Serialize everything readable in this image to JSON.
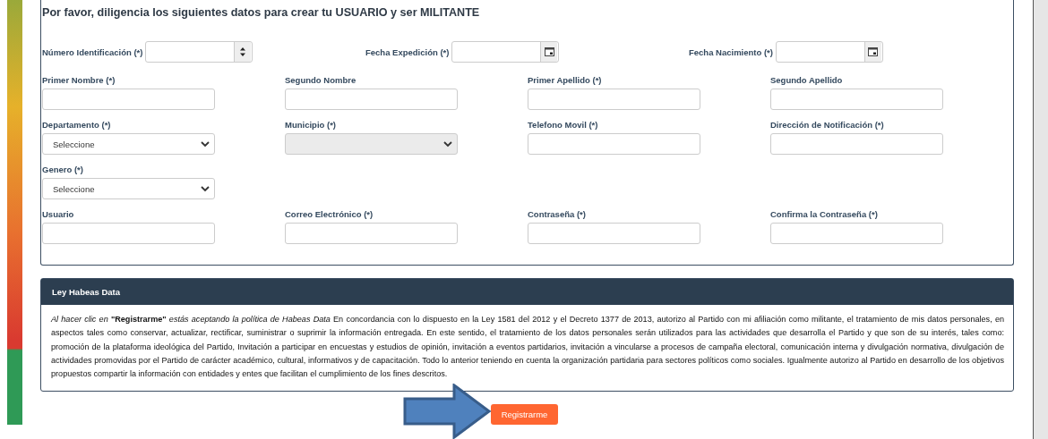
{
  "form": {
    "title": "Por favor, diligencia los siguientes datos para crear tu USUARIO y ser MILITANTE",
    "inline_fields": [
      {
        "label": "Número Identificación (*)",
        "kind": "number"
      },
      {
        "label": "Fecha Expedición (*)",
        "kind": "date"
      },
      {
        "label": "Fecha Nacimiento (*)",
        "kind": "date"
      }
    ],
    "rows": [
      [
        {
          "label": "Primer Nombre (*)",
          "kind": "text"
        },
        {
          "label": "Segundo Nombre",
          "kind": "text"
        },
        {
          "label": "Primer Apellido (*)",
          "kind": "text"
        },
        {
          "label": "Segundo Apellido",
          "kind": "text"
        }
      ],
      [
        {
          "label": "Departamento (*)",
          "kind": "select",
          "value": "Seleccione",
          "disabled": false
        },
        {
          "label": "Municipio (*)",
          "kind": "select",
          "disabled": true
        },
        {
          "label": "Telefono Movil (*)",
          "kind": "text"
        },
        {
          "label": "Dirección de Notificación (*)",
          "kind": "text"
        }
      ],
      [
        {
          "label": "Genero (*)",
          "kind": "select",
          "value": "Seleccione",
          "disabled": false
        }
      ],
      [
        {
          "label": "Usuario",
          "kind": "text"
        },
        {
          "label": "Correo Electrónico (*)",
          "kind": "text"
        },
        {
          "label": "Contraseña (*)",
          "kind": "text"
        },
        {
          "label": "Confirma la Contraseña (*)",
          "kind": "text"
        }
      ]
    ]
  },
  "habeas": {
    "title": "Ley Habeas Data",
    "text": "*Al hacer clic en* **\"Registrarme\"** *estás aceptando la política de Habeas Data* En concordancia con lo dispuesto en la Ley 1581 del 2012 y el Decreto 1377 de 2013, autorizo al Partido con mi afiliación como militante, el tratamiento de mis datos personales, en aspectos tales como conservar, actualizar, rectificar, suministrar o suprimir la información entregada. En este sentido, el tratamiento de los datos personales serán utilizados para las actividades que desarrolla el Partido y que son de su interés, tales como: promoción de la plataforma ideológica del Partido, Invitación a participar en encuestas y estudios de opinión, invitación a eventos partidarios, invitación a vincularse a procesos de campaña electoral, comunicación interna y divulgación normativa, divulgación de actividades promovidas por el Partido de carácter académico, cultural, informativos y de capacitación. Todo lo anterior teniendo en cuenta la organización partidaria para sectores políticos como sociales. Igualmente autorizo al Partido en desarrollo de los objetivos propuestos compartir la información con entidades y entes que facilitan el cumplimiento de los fines descritos."
  },
  "submit_button": "Registrarme"
}
